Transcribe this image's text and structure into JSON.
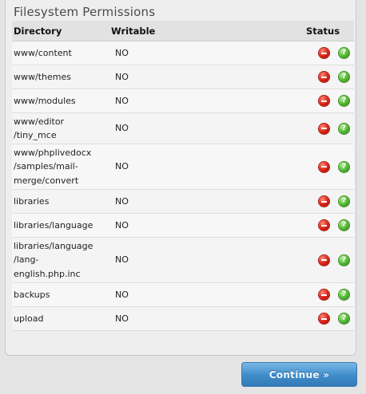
{
  "panel": {
    "title": "Filesystem Permissions"
  },
  "table": {
    "headers": {
      "directory": "Directory",
      "writable": "Writable",
      "status": "Status"
    },
    "rows": [
      {
        "dir_lines": [
          "www/content"
        ],
        "writable": "NO"
      },
      {
        "dir_lines": [
          "www/themes"
        ],
        "writable": "NO"
      },
      {
        "dir_lines": [
          "www/modules"
        ],
        "writable": "NO"
      },
      {
        "dir_lines": [
          "www/editor",
          "/tiny_mce"
        ],
        "writable": "NO"
      },
      {
        "dir_lines": [
          "www/phplivedocx",
          "/samples/mail-",
          "merge/convert"
        ],
        "writable": "NO"
      },
      {
        "dir_lines": [
          "libraries"
        ],
        "writable": "NO"
      },
      {
        "dir_lines": [
          "libraries/language"
        ],
        "writable": "NO"
      },
      {
        "dir_lines": [
          "libraries/language",
          "/lang-",
          "english.php.inc"
        ],
        "writable": "NO"
      },
      {
        "dir_lines": [
          "backups"
        ],
        "writable": "NO"
      },
      {
        "dir_lines": [
          "upload"
        ],
        "writable": "NO"
      }
    ],
    "status_icons": [
      "no-entry-icon",
      "help-icon"
    ],
    "help_glyph": "?"
  },
  "footer": {
    "continue_label": "Continue »"
  },
  "colors": {
    "accent": "#3f8ccb",
    "error": "#d81e10",
    "help": "#4fb430"
  }
}
